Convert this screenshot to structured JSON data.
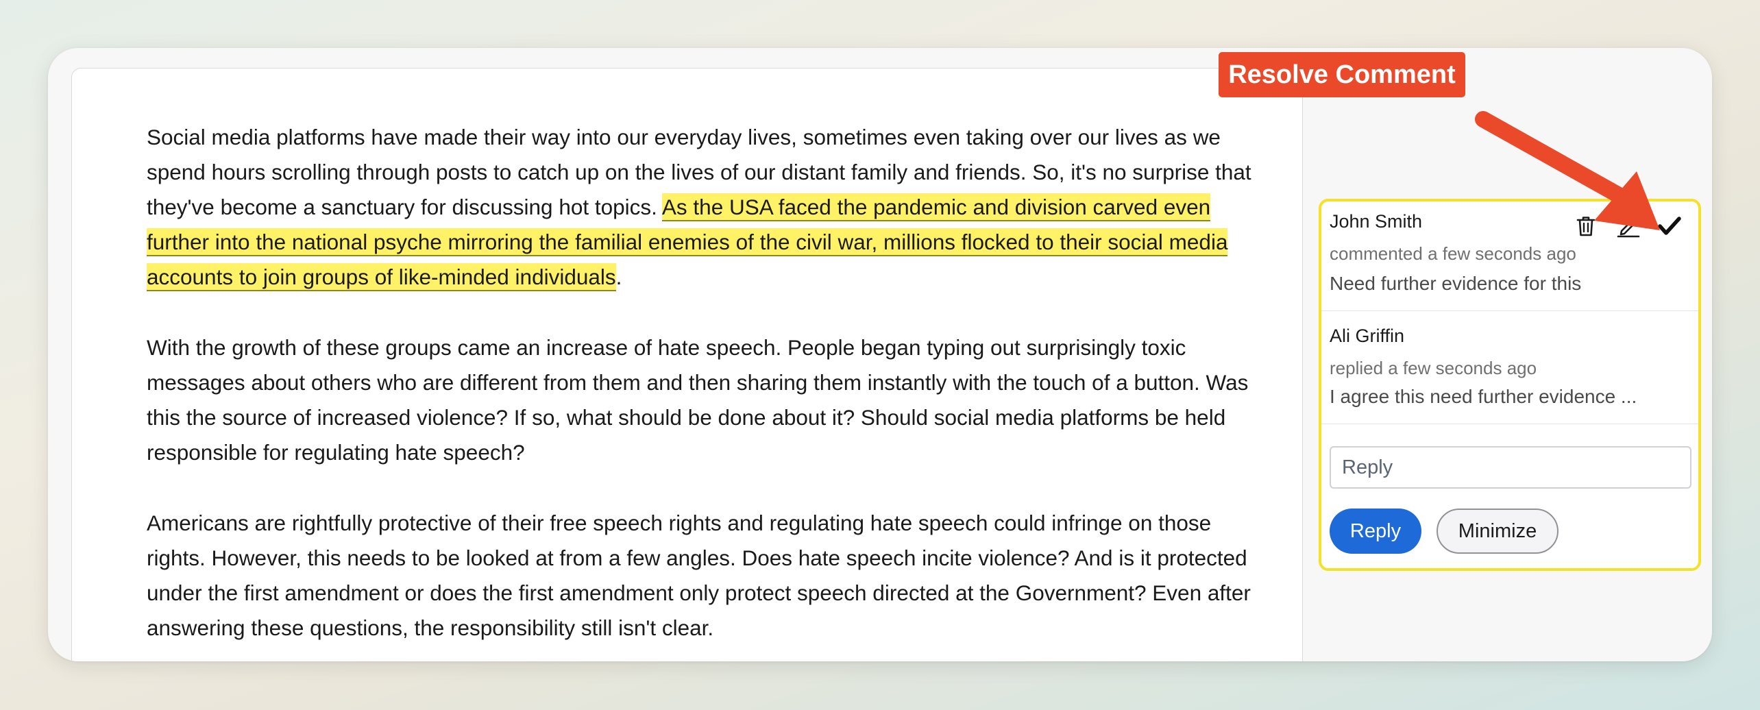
{
  "document": {
    "paragraphs": [
      {
        "before": "Social media platforms have made their way into our everyday lives, sometimes even taking over our lives as we spend hours scrolling through posts to catch up on the lives of our distant family and friends. So, it's no surprise that they've become a sanctuary for discussing hot topics. ",
        "highlight": "As the USA faced the pandemic and division carved even further into the national psyche mirroring the familial enemies of the civil war, millions flocked to their social media accounts to join groups of like-minded individuals",
        "after": "."
      },
      {
        "text": "With the growth of these groups came an increase of hate speech. People began typing out surprisingly toxic messages about others who are different from them and then sharing them instantly with the touch of a button. Was this the source of increased violence? If so, what should be done about it? Should social media platforms be held responsible for regulating hate speech?"
      },
      {
        "text": "Americans are rightfully protective of their free speech rights and regulating hate speech could infringe on those rights. However, this needs to be looked at from a few angles. Does hate speech incite violence? And is it protected under the first amendment or does the first amendment only protect speech directed at the Government? Even after answering these questions, the responsibility still isn't clear."
      }
    ],
    "highlight_color": "#fff266"
  },
  "comment_card": {
    "border_color": "#f5e02a",
    "threads": [
      {
        "author": "John Smith",
        "meta": "commented a few seconds ago",
        "body": "Need further evidence for this",
        "actions": [
          "trash-icon",
          "pencil-icon",
          "checkmark-icon"
        ]
      },
      {
        "author": "Ali Griffin",
        "meta": "replied a few seconds ago",
        "body": "I agree this need further evidence ..."
      }
    ],
    "reply_placeholder": "Reply",
    "reply_button": "Reply",
    "minimize_button": "Minimize",
    "accent_color": "#1e6ad8"
  },
  "annotation": {
    "callout_label": "Resolve Comment",
    "callout_color": "#ea4a2a"
  }
}
